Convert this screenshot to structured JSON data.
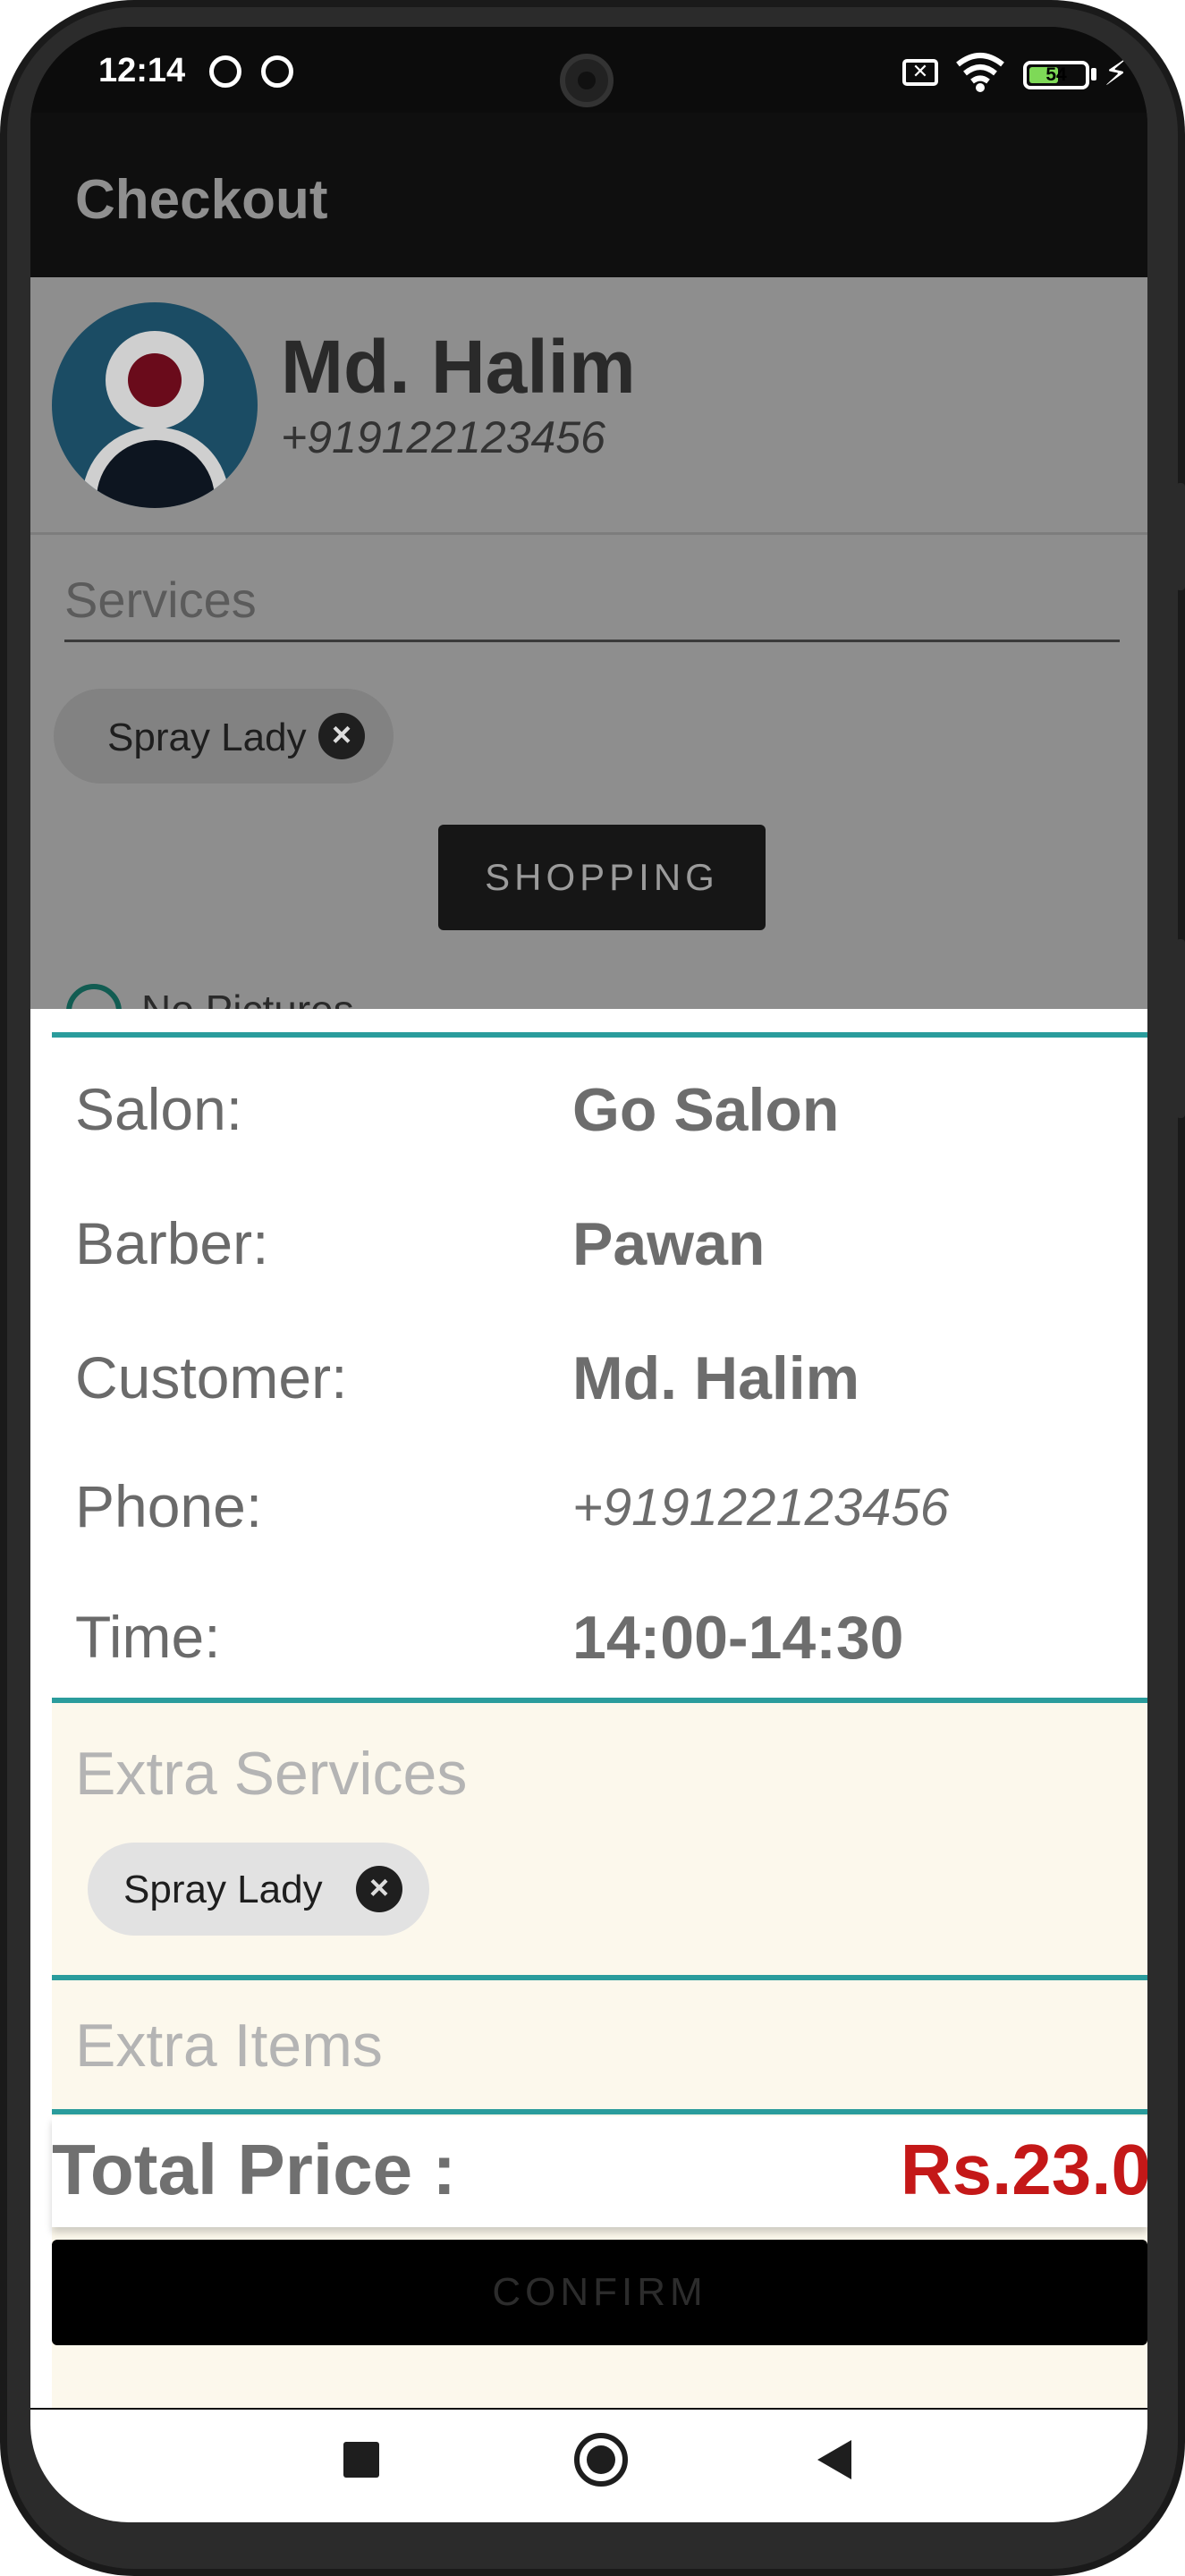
{
  "status_bar": {
    "time": "12:14",
    "sim_badge": "✕",
    "battery": "54",
    "charge_icon": "⚡"
  },
  "app_bar": {
    "title": "Checkout"
  },
  "background": {
    "customer_name": "Md. Halim",
    "customer_phone": "+919122123456",
    "services_label": "Services",
    "service_chip": "Spray Lady",
    "shopping_button": "SHOPPING",
    "radio_label": "No Pictures"
  },
  "dialog": {
    "rows": [
      {
        "label": "Salon:",
        "value": "Go Salon"
      },
      {
        "label": "Barber:",
        "value": "Pawan"
      },
      {
        "label": "Customer:",
        "value": "Md. Halim"
      },
      {
        "label": "Phone:",
        "value": "+919122123456"
      },
      {
        "label": "Time:",
        "value": "14:00-14:30"
      }
    ],
    "extra_services_title": "Extra Services",
    "extra_service_chip": "Spray Lady",
    "extra_items_title": "Extra Items",
    "total_label": "Total Price :",
    "total_value": "Rs.23.0",
    "confirm_label": "CONFIRM"
  },
  "colors": {
    "accent_teal": "#2a9c9c",
    "price_red": "#c41818",
    "cream": "#fcf8ec"
  },
  "icons": {
    "chip_remove": "close-circle-icon",
    "nav": [
      "recent-apps-icon",
      "home-icon",
      "back-icon"
    ]
  }
}
